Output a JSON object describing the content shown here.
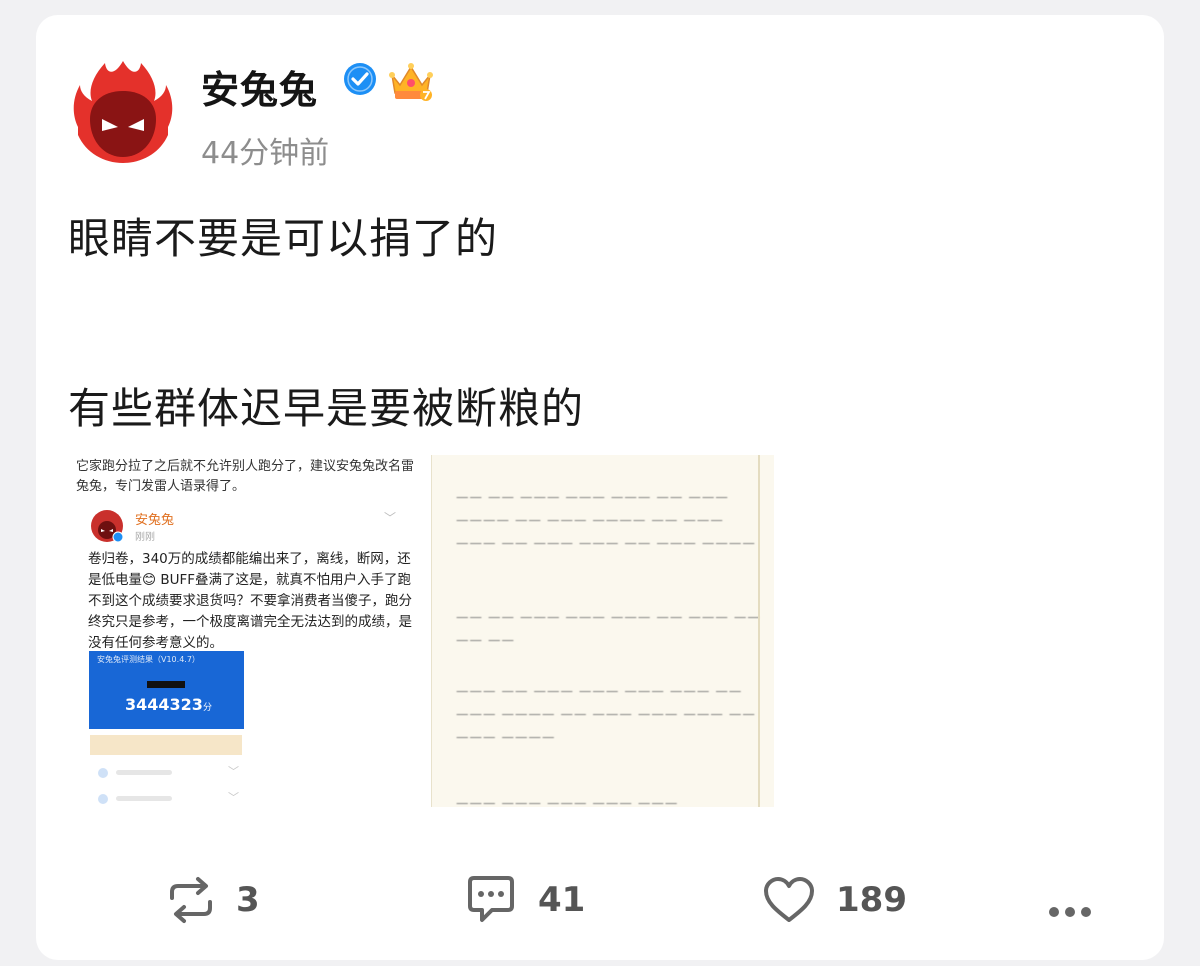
{
  "post": {
    "author": "安兔兔",
    "time": "44分钟前",
    "text_line1": "眼睛不要是可以捐了的",
    "text_line2": "有些群体迟早是要被断粮的"
  },
  "image1": {
    "top_text": "它家跑分拉了之后就不允许别人跑分了，建议安兔兔改名雷兔兔，专门发雷人语录得了。",
    "inner_author": "安兔兔",
    "inner_time": "刚刚",
    "inner_body": "卷归卷，340万的成绩都能编出来了，离线，断网，还是低电量😊 BUFF叠满了这是，就真不怕用户入手了跑不到这个成绩要求退货吗？不要拿消费者当傻子，跑分终究只是参考，一个极度离谱完全无法达到的成绩，是没有任何参考意义的。",
    "screen_title": "安兔兔评测结果（V10.4.7）",
    "score": "3444323",
    "score_unit": "分"
  },
  "actions": {
    "repost_count": "3",
    "comment_count": "41",
    "like_count": "189"
  }
}
